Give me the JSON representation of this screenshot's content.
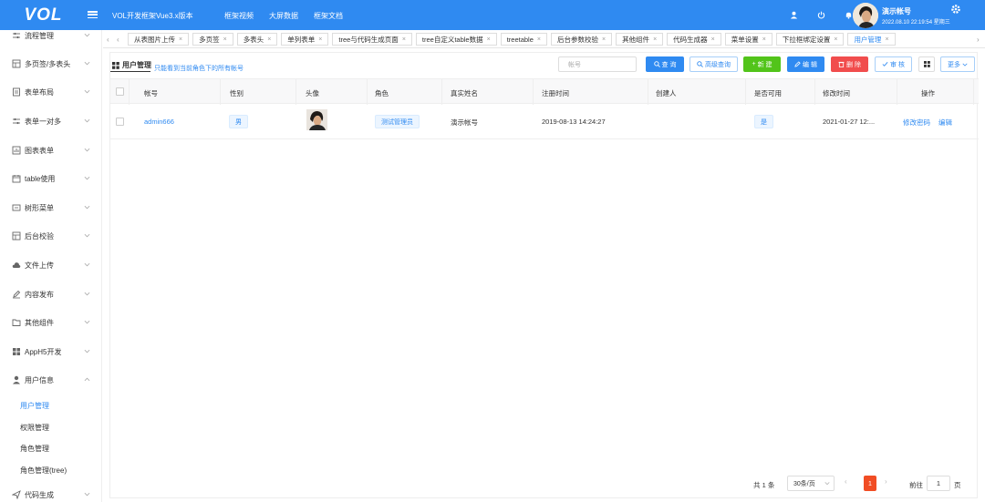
{
  "header": {
    "logo": "VOL",
    "title": "VOL开发框架Vue3.x版本",
    "links": [
      "框架视频",
      "大屏数据",
      "框架文档"
    ],
    "user_name": "演示帐号",
    "user_time": "2022.08.10 22:19:54 星期三",
    "icons": [
      "user-icon",
      "power-icon",
      "bell-icon",
      "gear-icon"
    ]
  },
  "sidebar": {
    "items": [
      {
        "label": "流程管理",
        "icon": "sliders-icon"
      },
      {
        "label": "多页签/多表头",
        "icon": "table-icon"
      },
      {
        "label": "表单布局",
        "icon": "document-icon"
      },
      {
        "label": "表单一对多",
        "icon": "sliders-icon"
      },
      {
        "label": "图表表单",
        "icon": "chart-icon"
      },
      {
        "label": "table使用",
        "icon": "calendar-icon"
      },
      {
        "label": "树形菜单",
        "icon": "tree-icon"
      },
      {
        "label": "后台校验",
        "icon": "table-icon"
      },
      {
        "label": "文件上传",
        "icon": "cloud-upload-icon"
      },
      {
        "label": "内容发布",
        "icon": "pen-icon"
      },
      {
        "label": "其他组件",
        "icon": "folder-icon"
      },
      {
        "label": "AppH5开发",
        "icon": "grid-icon"
      },
      {
        "label": "用户信息",
        "icon": "user-icon"
      }
    ],
    "subitems": [
      {
        "label": "用户管理",
        "active": true
      },
      {
        "label": "权限管理",
        "active": false
      },
      {
        "label": "角色管理",
        "active": false
      },
      {
        "label": "角色管理(tree)",
        "active": false
      }
    ],
    "last_item": {
      "label": "代码生成",
      "icon": "send-icon"
    }
  },
  "tabs": [
    {
      "label": "从表图片上传",
      "active": false
    },
    {
      "label": "多页签",
      "active": false
    },
    {
      "label": "多表头",
      "active": false
    },
    {
      "label": "单列表单",
      "active": false
    },
    {
      "label": "tree与代码生成页面",
      "active": false
    },
    {
      "label": "tree自定义table数据",
      "active": false
    },
    {
      "label": "treetable",
      "active": false
    },
    {
      "label": "后台参数校验",
      "active": false
    },
    {
      "label": "其他组件",
      "active": false
    },
    {
      "label": "代码生成器",
      "active": false
    },
    {
      "label": "菜单设置",
      "active": false
    },
    {
      "label": "下拉框绑定设置",
      "active": false
    },
    {
      "label": "用户管理",
      "active": true
    }
  ],
  "page": {
    "title": "用户管理",
    "hint": "只能看到当前角色下的所有帐号",
    "search_placeholder": "帐号",
    "buttons": {
      "query": "查 询",
      "advanced": "高级查询",
      "add": "新 建",
      "edit": "编 辑",
      "delete": "删 除",
      "audit": "审 核",
      "more": "更多"
    }
  },
  "table": {
    "columns": [
      "帐号",
      "性别",
      "头像",
      "角色",
      "真实姓名",
      "注册时间",
      "创建人",
      "是否可用",
      "修改时间",
      "操作"
    ],
    "rows": [
      {
        "account": "admin666",
        "gender": "男",
        "role": "测试管理员",
        "real_name": "演示帐号",
        "register_time": "2019-08-13 14:24:27",
        "creator": "",
        "enabled": "是",
        "modify_time": "2021-01-27 12:...",
        "actions": [
          "修改密码",
          "编辑"
        ]
      }
    ]
  },
  "pager": {
    "total": "共 1 条",
    "page_size": "30条/页",
    "current_page": "1",
    "goto_label": "前往",
    "goto_value": "1",
    "page_label": "页"
  },
  "colors": {
    "primary": "#2f8af1",
    "success": "#52c41a",
    "danger": "#f14d4d"
  }
}
